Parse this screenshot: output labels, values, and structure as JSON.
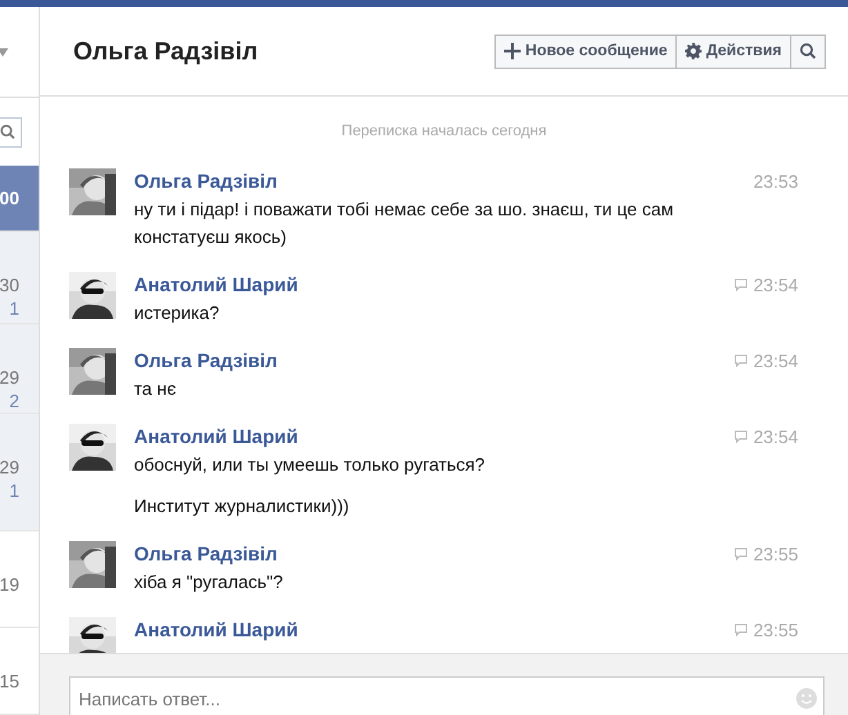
{
  "sidebar": {
    "items": [
      {
        "text_1": "00",
        "selected": true,
        "unread": false
      },
      {
        "text_1": "30",
        "text_2": "1",
        "selected": false,
        "unread": true
      },
      {
        "text_1": "29",
        "text_2": "2",
        "selected": false,
        "unread": true
      },
      {
        "text_1": "29",
        "text_2": "1",
        "selected": false,
        "unread": true
      },
      {
        "text_1": "19",
        "selected": false,
        "unread": false
      },
      {
        "text_1": "15",
        "selected": false,
        "unread": false
      }
    ]
  },
  "header": {
    "title": "Ольга Радзівіл",
    "buttons": [
      {
        "kind": "new",
        "label": "Новое сообщение"
      },
      {
        "kind": "actions",
        "label": "Действия"
      },
      {
        "kind": "search"
      }
    ]
  },
  "conversation": {
    "started": "Переписка началась сегодня",
    "messages": [
      {
        "author": "Ольга Радзівіл",
        "kind": "woman",
        "time": "23:53",
        "reply_icon": false,
        "paragraphs": [
          "ну ти і підар! і поважати тобі немає себе за шо.  знаєш, ти це сам констатуєш якось)"
        ]
      },
      {
        "author": "Анатолий Шарий",
        "kind": "man",
        "time": "23:54",
        "reply_icon": true,
        "paragraphs": [
          "истерика?"
        ]
      },
      {
        "author": "Ольга Радзівіл",
        "kind": "woman",
        "time": "23:54",
        "reply_icon": true,
        "paragraphs": [
          "та нє"
        ]
      },
      {
        "author": "Анатолий Шарий",
        "kind": "man",
        "time": "23:54",
        "reply_icon": true,
        "paragraphs": [
          "обоснуй, или ты умеешь только ругаться?",
          "Институт журналистики)))"
        ]
      },
      {
        "author": "Ольга Радзівіл",
        "kind": "woman",
        "time": "23:55",
        "reply_icon": true,
        "paragraphs": [
          "хіба я \"ругалась\"?"
        ]
      },
      {
        "author": "Анатолий Шарий",
        "kind": "man",
        "time": "23:55",
        "reply_icon": true
      }
    ]
  },
  "composer": {
    "placeholder": "Написать ответ..."
  }
}
